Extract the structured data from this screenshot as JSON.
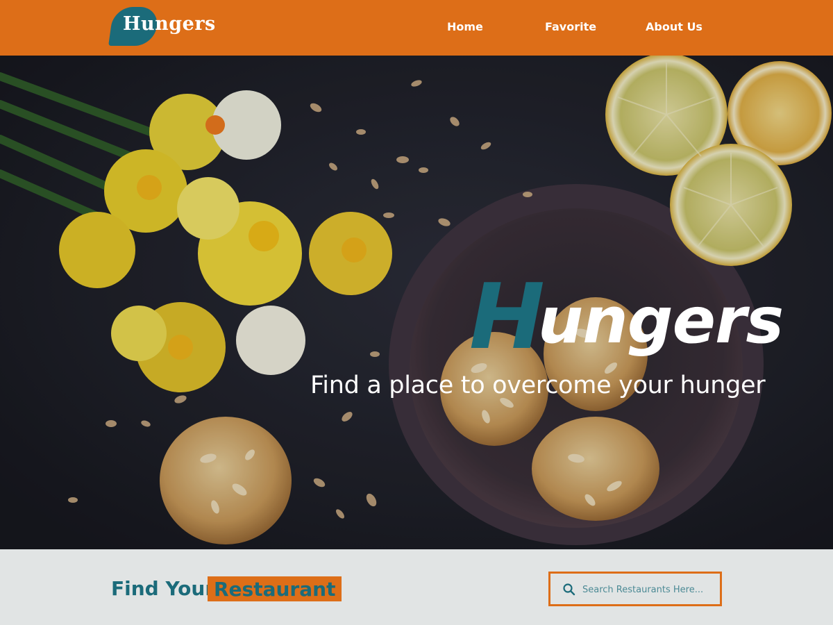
{
  "brand": {
    "logo_text": "Hungers",
    "primary_color": "#dd6e18",
    "secondary_color": "#1b6b7a"
  },
  "nav": {
    "items": [
      {
        "label": "Home"
      },
      {
        "label": "Favorite"
      },
      {
        "label": "About Us"
      }
    ]
  },
  "hero": {
    "title_initial": "H",
    "title_rest": "ungers",
    "subtitle": "Find a place to overcome your hunger",
    "image_subject": "dark table with daffodils, lemon slices, and almond cookies in a bowl"
  },
  "find_section": {
    "title": "Find Your",
    "highlight": "Restaurant",
    "search": {
      "placeholder": "Search Restaurants Here...",
      "value": "",
      "icon": "search-icon"
    }
  }
}
